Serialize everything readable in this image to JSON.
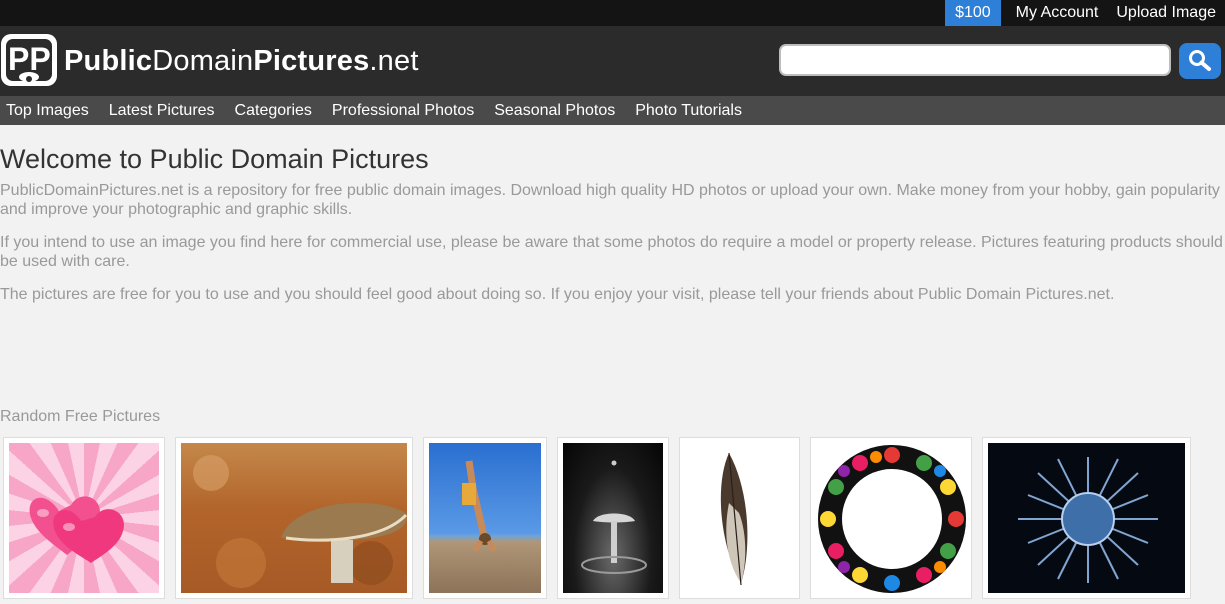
{
  "topbar": {
    "credit": "$100",
    "my_account": "My Account",
    "upload_image": "Upload Image"
  },
  "header": {
    "logo_bold1": "Public",
    "logo_regular": "Domain",
    "logo_bold2": "Pictures",
    "logo_suffix": ".net",
    "search_value": ""
  },
  "nav": {
    "items": [
      "Top Images",
      "Latest Pictures",
      "Categories",
      "Professional Photos",
      "Seasonal Photos",
      "Photo Tutorials"
    ]
  },
  "main": {
    "title": "Welcome to Public Domain Pictures",
    "para1": "PublicDomainPictures.net is a repository for free public domain images. Download high quality HD photos or upload your own. Make money from your hobby, gain popularity and improve your photographic and graphic skills.",
    "para2": "If you intend to use an image you find here for commercial use, please be aware that some photos do require a model or property release. Pictures featuring products should be used with care.",
    "para3": "The pictures are free for you to use and you should feel good about doing so. If you enjoy your visit, please tell your friends about Public Domain Pictures.net.",
    "random_title": "Random Free Pictures"
  },
  "colors": {
    "accent": "#2e7fd8",
    "topbar_bg": "#141414",
    "header_bg": "#2b2b2b",
    "nav_bg": "#4a4a4a",
    "page_bg": "#f2f2f2"
  },
  "icons": [
    "logo-icon",
    "search-icon"
  ]
}
